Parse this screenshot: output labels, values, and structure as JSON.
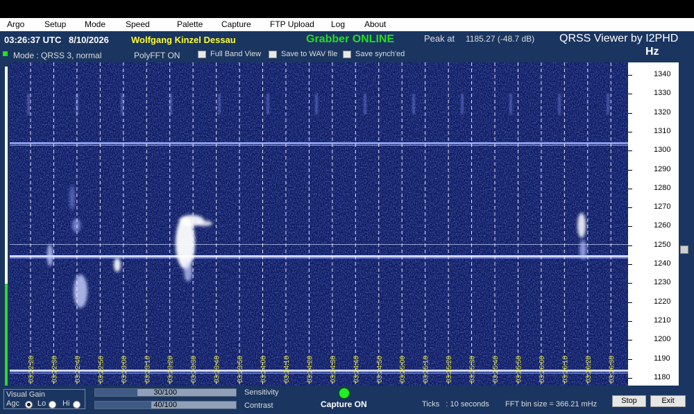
{
  "menu": {
    "items": [
      "Argo",
      "Setup",
      "Mode",
      "Speed",
      "Palette",
      "Capture",
      "FTP Upload",
      "Log",
      "About"
    ]
  },
  "status": {
    "time": "03:26:37 UTC",
    "date": "8/10/2026",
    "station": "Wolfgang Kinzel Dessau",
    "grabber": "Grabber ONLINE",
    "peak_label": "Peak at",
    "peak_value": "1185.27 (-48.7 dB)",
    "app_title": "QRSS Viewer by I2PHD",
    "unit": "Hz"
  },
  "options": {
    "mode": "Mode : QRSS 3, normal",
    "polyfft": "PolyFFT ON",
    "full_band": "Full Band View",
    "save_wav": "Save to WAV file",
    "save_synch": "Save synch'ed"
  },
  "freq_scale": {
    "labels": [
      "1340",
      "1330",
      "1320",
      "1310",
      "1300",
      "1290",
      "1280",
      "1270",
      "1260",
      "1250",
      "1240",
      "1230",
      "1220",
      "1210",
      "1200",
      "1190",
      "1180"
    ]
  },
  "time_axis": {
    "labels": [
      "03:22:20",
      "03:22:30",
      "03:22:40",
      "03:22:50",
      "03:23:00",
      "03:23:10",
      "03:23:20",
      "03:23:30",
      "03:23:40",
      "03:23:50",
      "03:24:00",
      "03:24:10",
      "03:24:20",
      "03:24:30",
      "03:24:40",
      "03:24:50",
      "03:25:00",
      "03:25:10",
      "03:25:20",
      "03:25:30",
      "03:25:40",
      "03:25:50",
      "03:26:00",
      "03:26:10",
      "03:26:20",
      "03:26:30"
    ]
  },
  "bottom": {
    "visual_gain": "Visual Gain",
    "agc": "Agc",
    "lo": "Lo",
    "hi": "Hi",
    "sensitivity_value": "30/100",
    "sensitivity_fraction": 0.3,
    "contrast_value": "40/100",
    "contrast_fraction": 0.4,
    "sensitivity_label": "Sensitivity",
    "contrast_label": "Contrast",
    "capture": "Capture ON",
    "ticks": "Ticks   : 10 seconds",
    "fft_bin": "FFT bin size = 366.21 mHz",
    "stop": "Stop",
    "exit": "Exit"
  },
  "level_meter": {
    "fraction": 0.32
  },
  "colors": {
    "accent_yellow": "#ffff33",
    "grabber_green": "#22dd22",
    "capture_led": "#22ee22",
    "waterfall_bg": "#0b1a5e"
  }
}
